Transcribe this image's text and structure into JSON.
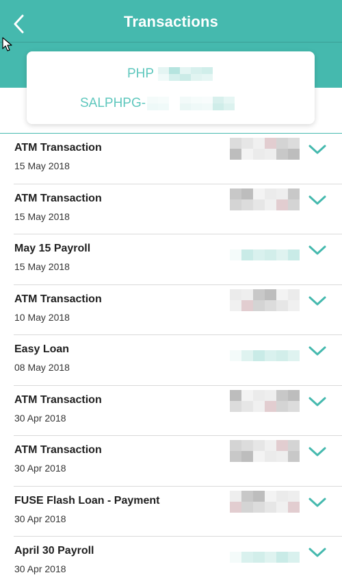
{
  "header": {
    "title": "Transactions",
    "back_icon": "chevron-left-icon",
    "color": "#45b9ae"
  },
  "account": {
    "currency_label": "PHP",
    "account_prefix": "SALPHPG-",
    "accent": "#5ec7bd"
  },
  "transactions": [
    {
      "name": "ATM Transaction",
      "date": "15 May 2018",
      "amount_style": "gray"
    },
    {
      "name": "ATM Transaction",
      "date": "15 May 2018",
      "amount_style": "gray"
    },
    {
      "name": "May 15 Payroll",
      "date": "15 May 2018",
      "amount_style": "teal"
    },
    {
      "name": "ATM Transaction",
      "date": "10 May 2018",
      "amount_style": "gray"
    },
    {
      "name": "Easy Loan",
      "date": "08 May 2018",
      "amount_style": "teal"
    },
    {
      "name": "ATM Transaction",
      "date": "30 Apr 2018",
      "amount_style": "gray"
    },
    {
      "name": "ATM Transaction",
      "date": "30 Apr 2018",
      "amount_style": "gray"
    },
    {
      "name": "FUSE Flash Loan - Payment",
      "date": "30 Apr 2018",
      "amount_style": "gray"
    },
    {
      "name": "April 30 Payroll",
      "date": "30 Apr 2018",
      "amount_style": "teal"
    }
  ],
  "colors": {
    "text_primary": "#1e1e1e",
    "chevron": "#45b9ae",
    "separator": "#d9d9d9"
  }
}
